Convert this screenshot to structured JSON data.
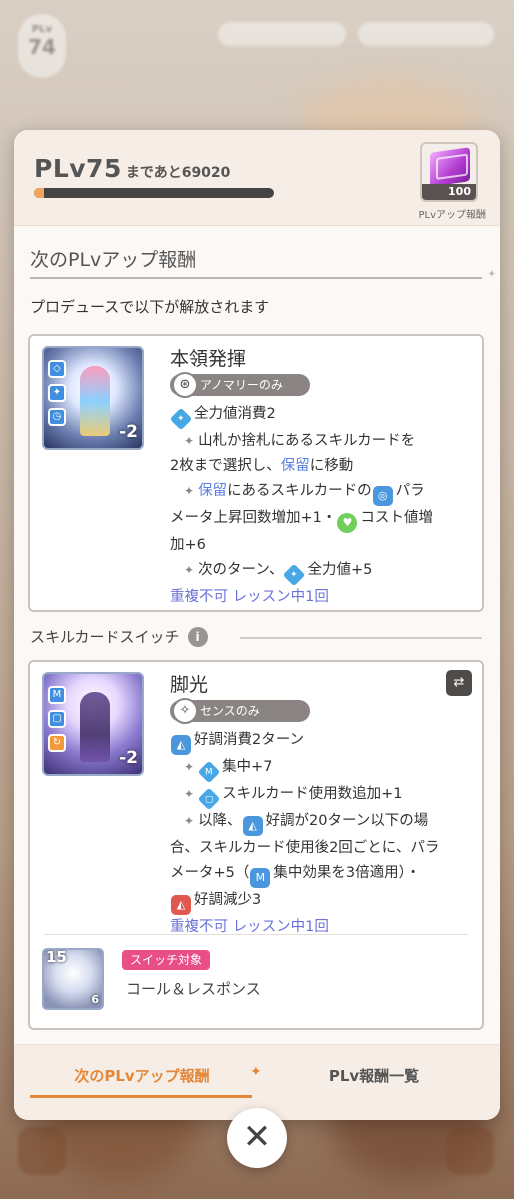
{
  "background": {
    "player_level_label": "PLv",
    "player_level": "74"
  },
  "panel": {
    "plv_label": "PLv75",
    "remaining_text": "まであと69020",
    "progress_fraction": 0.04,
    "reward_count": "100",
    "reward_label": "PLvアップ報酬",
    "section_title": "次のPLvアップ報酬",
    "description": "プロデュースで以下が解放されます",
    "card1": {
      "name": "本領発揮",
      "tag": "アノマリーのみ",
      "cost": "-2",
      "lines": [
        "全力値消費2",
        "山札か捨札にあるスキルカードを",
        "2枚まで選択し、保留に移動",
        "保留にあるスキルカードの",
        "パラ",
        "メータ上昇回数増加+1・",
        "コスト値増",
        "加+6",
        "次のターン、",
        "全力値+5"
      ],
      "highlight_word": "保留",
      "footer": "重複不可 レッスン中1回"
    },
    "switch_section_title": "スキルカードスイッチ",
    "card2": {
      "name": "脚光",
      "tag": "センスのみ",
      "cost": "-2",
      "lines": [
        "好調消費2ターン",
        "集中+7",
        "スキルカード使用数追加+1",
        "以降、",
        "好調が20ターン以下の場",
        "合、スキルカード使用後2回ごとに、パラ",
        "メータ+5（",
        "集中効果を3倍適用）・",
        "好調減少3"
      ],
      "footer": "重複不可 レッスン中1回",
      "switch_target_tag": "スイッチ対象",
      "switch_target_name": "コール＆レスポンス",
      "switch_target_cost": "15",
      "switch_target_value": "6"
    },
    "tabs": [
      {
        "label": "次のPLvアップ報酬",
        "active": true
      },
      {
        "label": "PLv報酬一覧",
        "active": false
      }
    ]
  },
  "colors": {
    "accent": "#e3883a",
    "highlight_blue": "#5a7fe0",
    "footer_purple": "#6b73d8",
    "switch_pink": "#e84f86"
  }
}
